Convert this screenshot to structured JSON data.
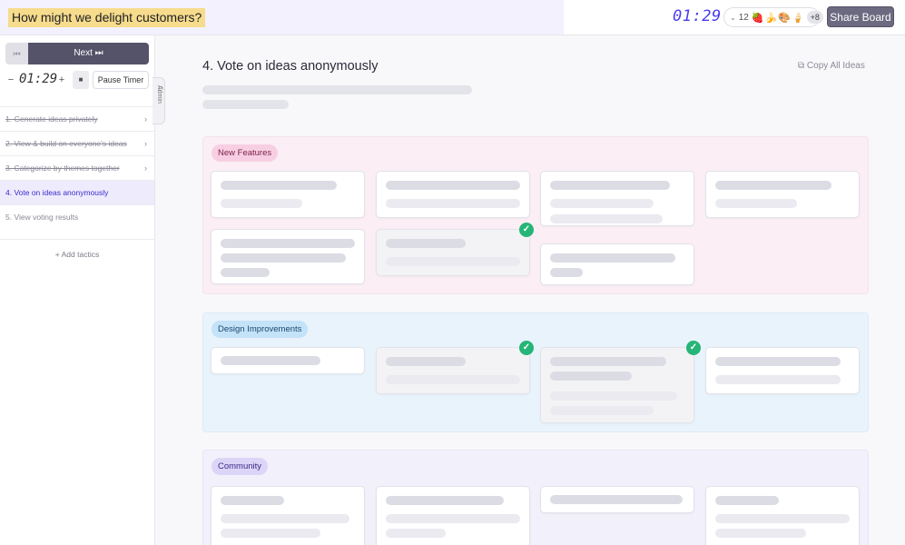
{
  "header": {
    "board_title": "How might we delight customers?",
    "timer": "01:29",
    "participant_count": "12",
    "participant_emojis": [
      "🍓",
      "🍌",
      "🎨",
      "🍦"
    ],
    "participants_more": "+8",
    "share_label": "Share Board"
  },
  "sidebar": {
    "next_label": "Next ⏭",
    "timer": "01:29",
    "minus": "−",
    "plus": "+",
    "stop": "■",
    "pause_label": "Pause Timer",
    "admin_label": "Admin",
    "steps": [
      {
        "label": "1. Generate ideas privately",
        "state": "done"
      },
      {
        "label": "2. View & build on everyone's ideas",
        "state": "done"
      },
      {
        "label": "3. Categorize by themes together",
        "state": "done"
      },
      {
        "label": "4. Vote on ideas anonymously",
        "state": "active"
      },
      {
        "label": "5. View voting results",
        "state": "upcoming"
      }
    ],
    "add_tactics": "+ Add tactics"
  },
  "main": {
    "step_title": "4.  Vote on ideas anonymously",
    "copy_all": "Copy All Ideas",
    "groups": [
      {
        "label": "New Features"
      },
      {
        "label": "Design Improvements"
      },
      {
        "label": "Community"
      }
    ]
  },
  "colors": {
    "accent": "#4b3cf0",
    "check": "#25b577",
    "new_features_bg": "#fbeef4",
    "design_improvements_bg": "#e9f3fb",
    "community_bg": "#f2f0fb"
  }
}
